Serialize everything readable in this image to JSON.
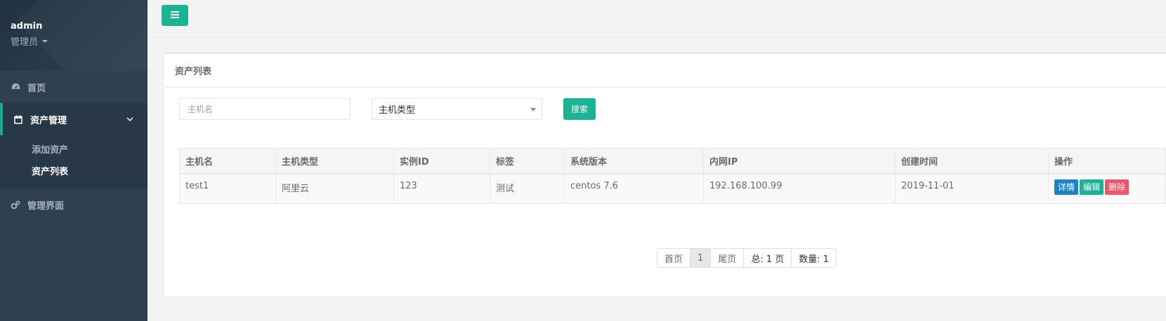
{
  "sidebar": {
    "profile": {
      "name": "admin",
      "role": "管理员"
    },
    "home_label": "首页",
    "asset_label": "资产管理",
    "sub_items": [
      {
        "label": "添加资产"
      },
      {
        "label": "资产列表"
      }
    ],
    "admin_label": "管理界面"
  },
  "panel": {
    "title": "资产列表",
    "search_placeholder": "主机名",
    "type_select_value": "主机类型",
    "search_button": "搜索"
  },
  "table": {
    "headers": [
      "主机名",
      "主机类型",
      "实例ID",
      "标签",
      "系统版本",
      "内网IP",
      "创建时间",
      "操作"
    ],
    "rows": [
      {
        "hostname": "test1",
        "type": "阿里云",
        "instance_id": "123",
        "tag": "测试",
        "os": "centos 7.6",
        "ip": "192.168.100.99",
        "created": "2019-11-01"
      }
    ],
    "actions": {
      "detail": "详情",
      "edit": "编辑",
      "delete": "删除"
    }
  },
  "pagination": {
    "first": "首页",
    "current": "1",
    "last": "尾页",
    "total_pages": "总: 1 页",
    "count": "数量: 1"
  },
  "colors": {
    "sidebar_bg": "#2f4050",
    "accent": "#1ab394",
    "info": "#1c84c6",
    "danger": "#ed5565"
  }
}
